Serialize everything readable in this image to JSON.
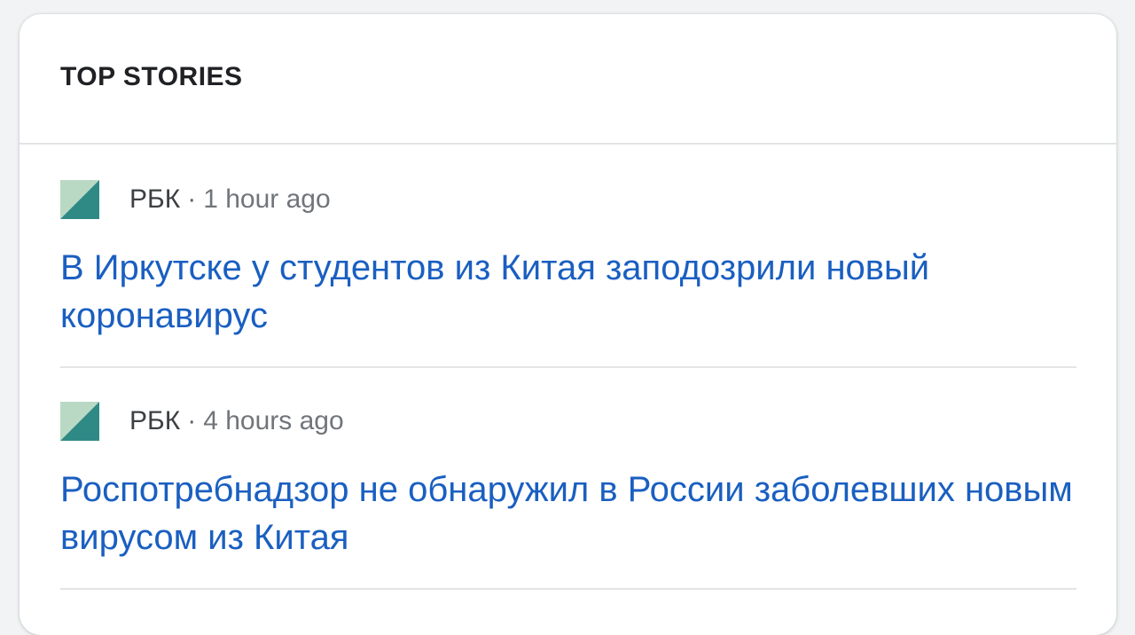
{
  "section": {
    "title": "TOP STORIES"
  },
  "stories": [
    {
      "source": "РБК",
      "separator": "·",
      "time": "1 hour ago",
      "headline": "В Иркутске у студентов из Китая заподозрили новый коронавирус",
      "logo_icon": "rbc-logo-icon"
    },
    {
      "source": "РБК",
      "separator": "·",
      "time": "4 hours ago",
      "headline": "Роспотребнадзор не обнаружил в России заболевших новым вирусом из Китая",
      "logo_icon": "rbc-logo-icon"
    }
  ],
  "colors": {
    "headline": "#1a5fc1",
    "logo_light": "#b9d9c4",
    "logo_dark": "#2f8a86"
  }
}
